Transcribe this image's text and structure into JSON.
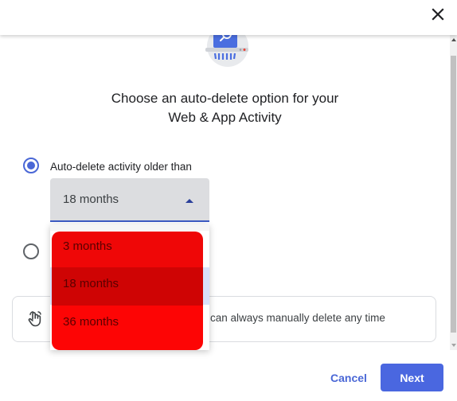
{
  "dialog": {
    "close_icon": "close-icon",
    "illustration_icon": "shredder-search-clock-illustration",
    "title_line1": "Choose an auto-delete option for your",
    "title_line2": "Web & App Activity"
  },
  "options": [
    {
      "label": "Auto-delete activity older than",
      "checked": true
    },
    {
      "label": "",
      "checked": false
    }
  ],
  "select": {
    "value": "18 months",
    "expanded": true,
    "caret_icon": "caret-up-icon",
    "items": [
      {
        "label": "3 months",
        "selected": false
      },
      {
        "label": "18 months",
        "selected": true
      },
      {
        "label": "36 months",
        "selected": false
      }
    ]
  },
  "info": {
    "icon": "hand-pointer-icon",
    "text": "can always manually delete any time"
  },
  "footer": {
    "cancel_label": "Cancel",
    "next_label": "Next"
  },
  "colors": {
    "accent": "#4a67e0",
    "select_bg": "#dcdde0",
    "highlight_row": "#d8e1fb",
    "overlay_red": "#ef0707"
  }
}
